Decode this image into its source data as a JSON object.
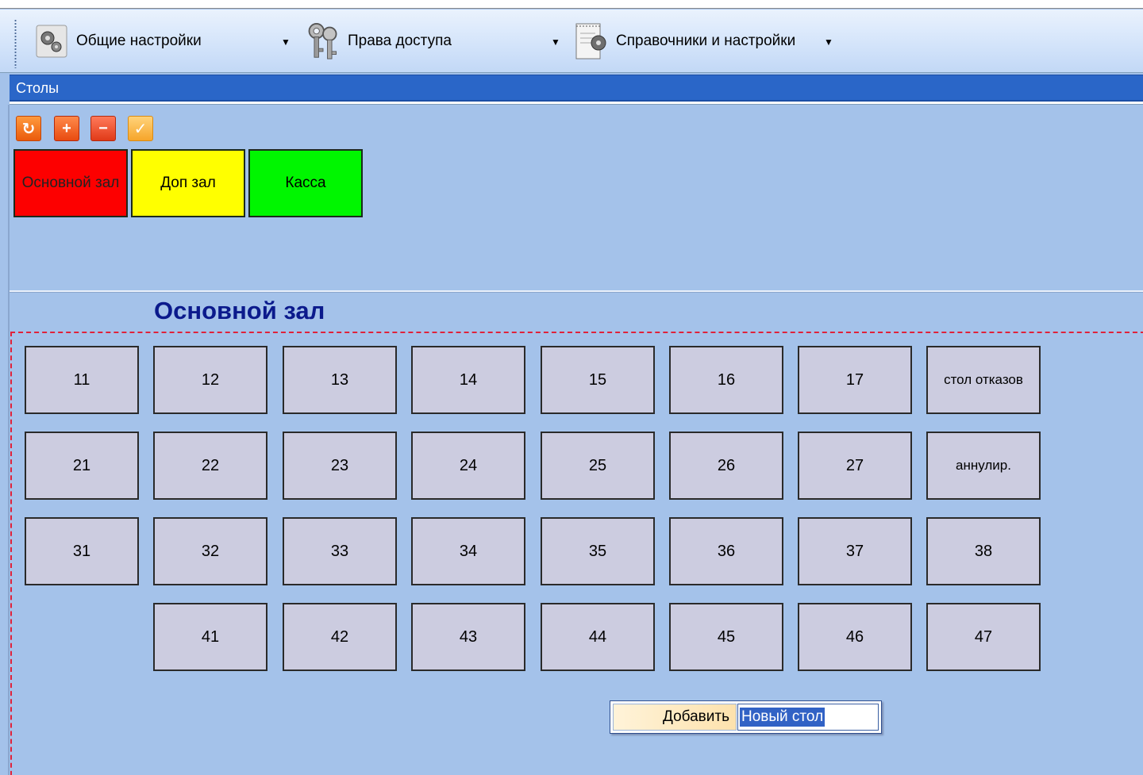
{
  "toolbar": {
    "items": [
      {
        "label": "Общие настройки",
        "icon": "gears-icon"
      },
      {
        "label": "Права доступа",
        "icon": "keys-icon"
      },
      {
        "label": "Справочники и настройки",
        "icon": "notepad-gear-icon"
      }
    ]
  },
  "window": {
    "title": "Столы"
  },
  "actions": {
    "refresh": "refresh-icon",
    "add": "plus-icon",
    "remove": "minus-icon",
    "apply": "check-icon"
  },
  "halls": [
    {
      "label": "Основной зал",
      "color": "#fd0000"
    },
    {
      "label": "Доп зал",
      "color": "#ffff00"
    },
    {
      "label": "Касса",
      "color": "#00f600"
    }
  ],
  "current_hall": {
    "title": "Основной зал"
  },
  "tables": {
    "row1": [
      "11",
      "12",
      "13",
      "14",
      "15",
      "16",
      "17",
      "стол отказов"
    ],
    "row2": [
      "21",
      "22",
      "23",
      "24",
      "25",
      "26",
      "27",
      "аннулир."
    ],
    "row3": [
      "31",
      "32",
      "33",
      "34",
      "35",
      "36",
      "37",
      "38"
    ],
    "row4": [
      "41",
      "42",
      "43",
      "44",
      "45",
      "46",
      "47"
    ]
  },
  "add_control": {
    "button_label": "Добавить",
    "input_value": "Новый стол"
  },
  "colors": {
    "background": "#a4c2ea",
    "titlebar": "#2a66c8",
    "table": "#cccce0",
    "hall_title": "#0b1a8c",
    "dashed_border": "#e0223a"
  }
}
